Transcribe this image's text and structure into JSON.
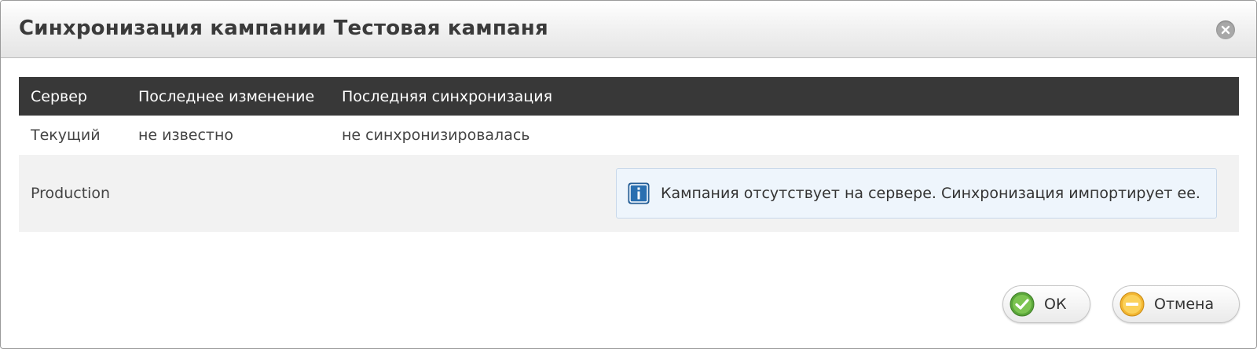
{
  "dialog": {
    "title": "Синхронизация кампании Тестовая кампаня",
    "close_icon": "close-icon"
  },
  "table": {
    "headers": [
      "Сервер",
      "Последнее изменение",
      "Последняя синхронизация"
    ],
    "rows": [
      {
        "server": "Текущий",
        "last_change": "не известно",
        "last_sync": "не синхронизировалась"
      },
      {
        "server": "Production",
        "last_change": "",
        "last_sync": "",
        "notice": "Кампания отсутствует на сервере. Синхронизация импортирует ее."
      }
    ]
  },
  "buttons": {
    "ok_label": "ОК",
    "cancel_label": "Отмена"
  },
  "colors": {
    "header_bg": "#383838",
    "notice_bg": "#eef5fc",
    "notice_border": "#c8d8ea",
    "ok_icon": "#5aa63a",
    "cancel_icon": "#f2b632",
    "info_icon": "#2a6fb0"
  },
  "icons": {
    "notice": "info-icon",
    "ok": "check-circle-icon",
    "cancel": "minus-circle-icon"
  }
}
